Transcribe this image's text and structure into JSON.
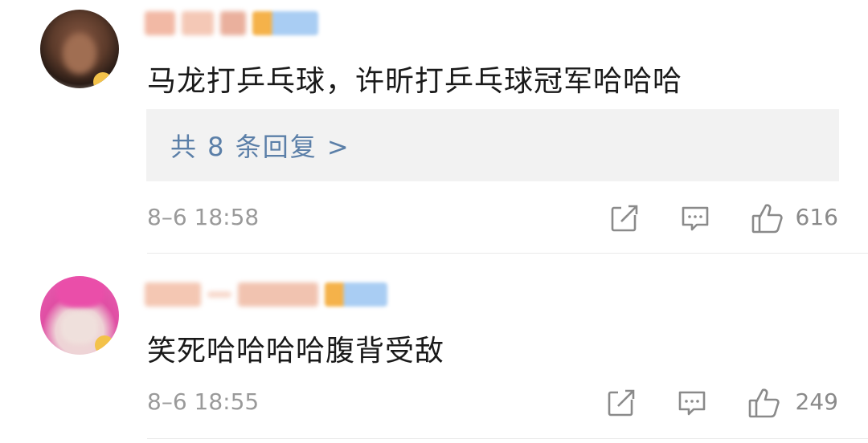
{
  "comments": [
    {
      "text": "马龙打乒乓球，许昕打乒乓球冠军哈哈哈",
      "reply_label": "共 8 条回复 >",
      "timestamp": "8–6 18:58",
      "like_count": "616",
      "icons": {
        "share": "share-icon",
        "comment": "comment-icon",
        "like": "thumbs-up-icon"
      }
    },
    {
      "text": "笑死哈哈哈哈腹背受敌",
      "timestamp": "8–6 18:55",
      "like_count": "249",
      "icons": {
        "share": "share-icon",
        "comment": "comment-icon",
        "like": "thumbs-up-icon"
      }
    }
  ],
  "colors": {
    "reply_link": "#5b7fa8",
    "meta_text": "#9a9a9a",
    "reply_bg": "#f2f2f2"
  }
}
